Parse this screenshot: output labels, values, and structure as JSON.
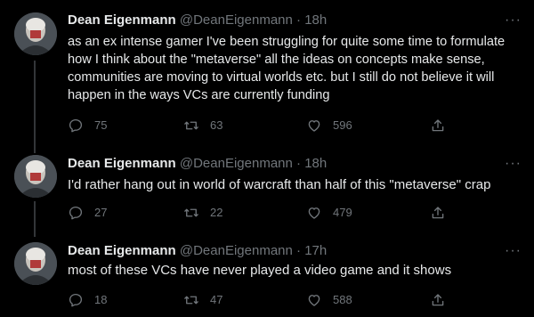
{
  "tweets": [
    {
      "name": "Dean Eigenmann",
      "handle": "@DeanEigenmann",
      "dot": "·",
      "time": "18h",
      "text": "as an ex intense gamer I've been struggling for quite some time to formulate how I think about the \"metaverse\" all the ideas on concepts make sense, communities are moving to virtual worlds etc. but I still do not believe it will happen in the ways VCs are currently funding",
      "replies": "75",
      "retweets": "63",
      "likes": "596",
      "more": "···"
    },
    {
      "name": "Dean Eigenmann",
      "handle": "@DeanEigenmann",
      "dot": "·",
      "time": "18h",
      "text": "I'd rather hang out in world of warcraft than half of this \"metaverse\" crap",
      "replies": "27",
      "retweets": "22",
      "likes": "479",
      "more": "···"
    },
    {
      "name": "Dean Eigenmann",
      "handle": "@DeanEigenmann",
      "dot": "·",
      "time": "17h",
      "text": "most of these VCs have never played a video game and it shows",
      "replies": "18",
      "retweets": "47",
      "likes": "588",
      "more": "···"
    }
  ],
  "icons": {
    "reply": "reply-icon",
    "retweet": "retweet-icon",
    "like": "heart-icon",
    "share": "share-icon",
    "more": "more-icon"
  },
  "colors": {
    "background": "#000000",
    "text": "#e7e9ea",
    "muted": "#71767b",
    "thread_line": "#333639"
  }
}
